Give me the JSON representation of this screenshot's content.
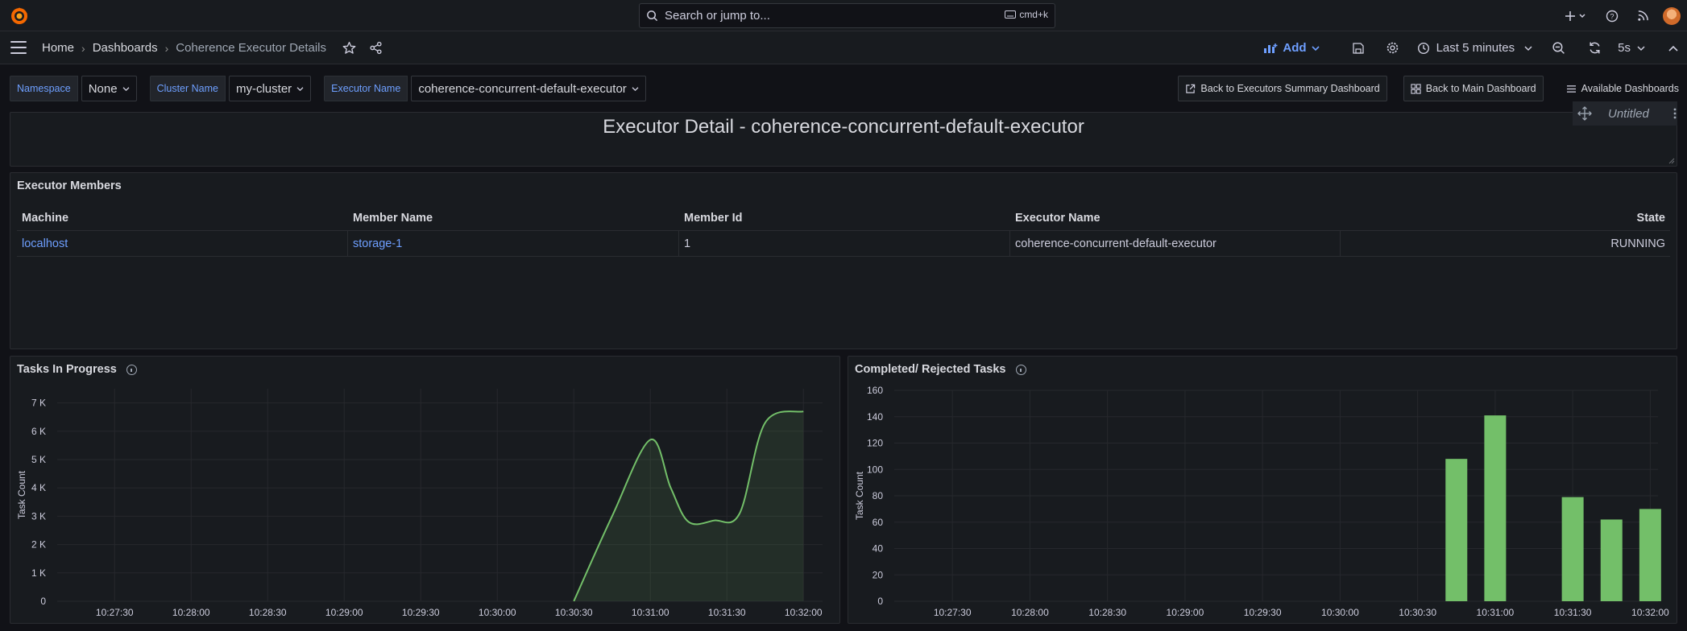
{
  "topbar": {
    "search_placeholder": "Search or jump to...",
    "search_shortcut": "cmd+k",
    "icons": [
      "grafana-logo-icon",
      "plus-icon",
      "help-icon",
      "news-icon",
      "avatar"
    ]
  },
  "nav": {
    "breadcrumb": [
      "Home",
      "Dashboards",
      "Coherence Executor Details"
    ],
    "add_label": "Add",
    "time_range": "Last 5 minutes",
    "refresh_interval": "5s"
  },
  "variables": [
    {
      "label": "Namespace",
      "value": "None"
    },
    {
      "label": "Cluster Name",
      "value": "my-cluster"
    },
    {
      "label": "Executor Name",
      "value": "coherence-concurrent-default-executor"
    }
  ],
  "links": {
    "executors_summary": "Back to Executors Summary Dashboard",
    "main_dashboard": "Back to Main Dashboard",
    "available": "Available Dashboards"
  },
  "text_panel": {
    "title": "Executor Detail - coherence-concurrent-default-executor",
    "untitled_label": "Untitled"
  },
  "table_panel": {
    "title": "Executor Members",
    "columns": [
      "Machine",
      "Member Name",
      "Member Id",
      "Executor Name",
      "State"
    ],
    "rows": [
      [
        "localhost",
        "storage-1",
        "1",
        "coherence-concurrent-default-executor",
        "RUNNING"
      ]
    ]
  },
  "chart_data": [
    {
      "type": "area",
      "title": "Tasks In Progress",
      "xlabel": "",
      "ylabel": "Task Count",
      "x": [
        "10:27:30",
        "10:28:00",
        "10:28:30",
        "10:29:00",
        "10:29:30",
        "10:30:00",
        "10:30:30",
        "10:31:00",
        "10:31:30",
        "10:32:00"
      ],
      "y_ticks": [
        "0",
        "1 K",
        "2 K",
        "3 K",
        "4 K",
        "5 K",
        "6 K",
        "7 K"
      ],
      "ylim": [
        0,
        7500
      ],
      "series": [
        {
          "color": "#73bf69",
          "points": [
            [
              "10:30:30",
              0
            ],
            [
              "10:30:45",
              3000
            ],
            [
              "10:31:00",
              5700
            ],
            [
              "10:31:08",
              4000
            ],
            [
              "10:31:15",
              2800
            ],
            [
              "10:31:25",
              2850
            ],
            [
              "10:31:35",
              3100
            ],
            [
              "10:31:45",
              6300
            ],
            [
              "10:32:00",
              6700
            ]
          ]
        }
      ],
      "grid": true
    },
    {
      "type": "bar",
      "title": "Completed/ Rejected Tasks",
      "xlabel": "",
      "ylabel": "Task Count",
      "x": [
        "10:27:30",
        "10:28:00",
        "10:28:30",
        "10:29:00",
        "10:29:30",
        "10:30:00",
        "10:30:30",
        "10:31:00",
        "10:31:30",
        "10:32:00"
      ],
      "y_ticks": [
        "0",
        "20",
        "40",
        "60",
        "80",
        "100",
        "120",
        "140",
        "160"
      ],
      "ylim": [
        0,
        160
      ],
      "series": [
        {
          "color": "#73bf69",
          "bars": [
            [
              "10:30:45",
              108
            ],
            [
              "10:31:00",
              141
            ],
            [
              "10:31:30",
              79
            ],
            [
              "10:31:45",
              62
            ],
            [
              "10:32:00",
              70
            ]
          ]
        }
      ],
      "grid": true
    }
  ]
}
